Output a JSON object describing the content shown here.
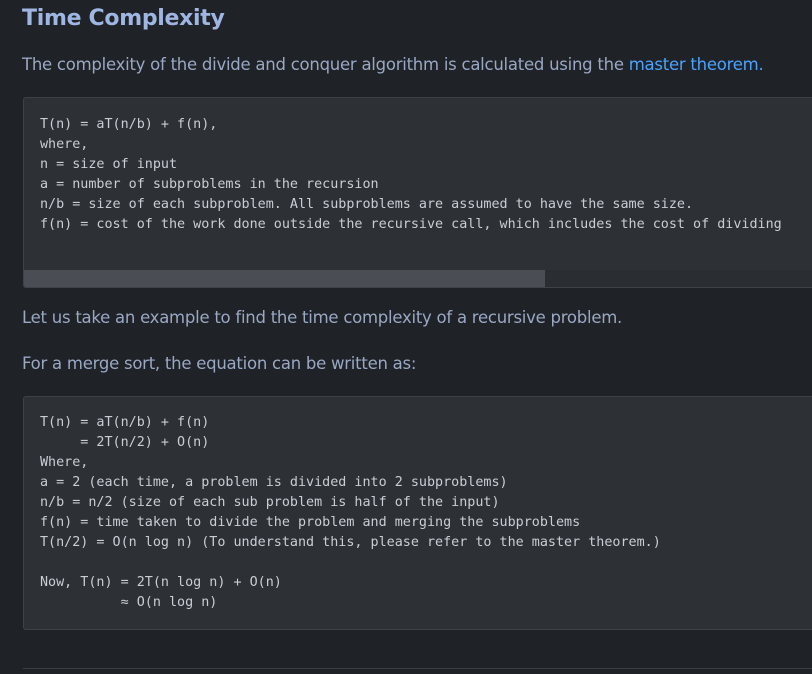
{
  "heading": "Time Complexity",
  "intro": {
    "text": "The complexity of the divide and conquer algorithm is calculated using the ",
    "link": "master theorem."
  },
  "code1": {
    "lines": [
      "T(n) = aT(n/b) + f(n),",
      "where,",
      "n = size of input",
      "a = number of subproblems in the recursion",
      "n/b = size of each subproblem. All subproblems are assumed to have the same size.",
      "f(n) = cost of the work done outside the recursive call, which includes the cost of dividing"
    ],
    "scroll_position_fraction": 0.66
  },
  "para2": "Let us take an example to find the time complexity of a recursive problem.",
  "para3": "For a merge sort, the equation can be written as:",
  "code2": {
    "lines": [
      "T(n) = aT(n/b) + f(n)",
      "     = 2T(n/2) + O(n)",
      "Where,",
      "a = 2 (each time, a problem is divided into 2 subproblems)",
      "n/b = n/2 (size of each sub problem is half of the input)",
      "f(n) = time taken to divide the problem and merging the subproblems",
      "T(n/2) = O(n log n) (To understand this, please refer to the master theorem.)",
      "",
      "Now, T(n) = 2T(n log n) + O(n)",
      "          ≈ O(n log n)"
    ]
  }
}
